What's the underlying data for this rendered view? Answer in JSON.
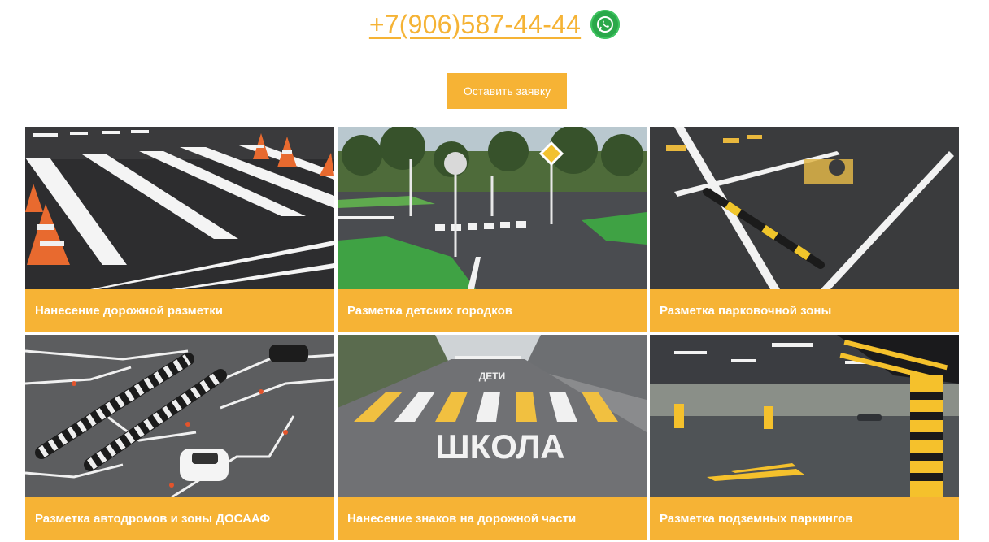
{
  "header": {
    "phone": "+7(906)587-44-44",
    "whatsapp_icon": "whatsapp-icon"
  },
  "cta": {
    "label": "Оставить заявку"
  },
  "colors": {
    "accent": "#f6b335",
    "whatsapp": "#2aa84a"
  },
  "cards": [
    {
      "title": "Нанесение дорожной разметки",
      "image": "crosswalk-photo"
    },
    {
      "title": "Разметка детских городков",
      "image": "kids-town-photo"
    },
    {
      "title": "Разметка парковочной зоны",
      "image": "parking-photo"
    },
    {
      "title": "Разметка автодромов и зоны ДОСААФ",
      "image": "autodrome-photo"
    },
    {
      "title": "Нанесение знаков на дорожной части",
      "image": "school-road-photo",
      "road_text": "ШКОЛА",
      "road_text_small": "ДЕТИ"
    },
    {
      "title": "Разметка подземных паркингов",
      "image": "underground-parking-photo"
    }
  ]
}
